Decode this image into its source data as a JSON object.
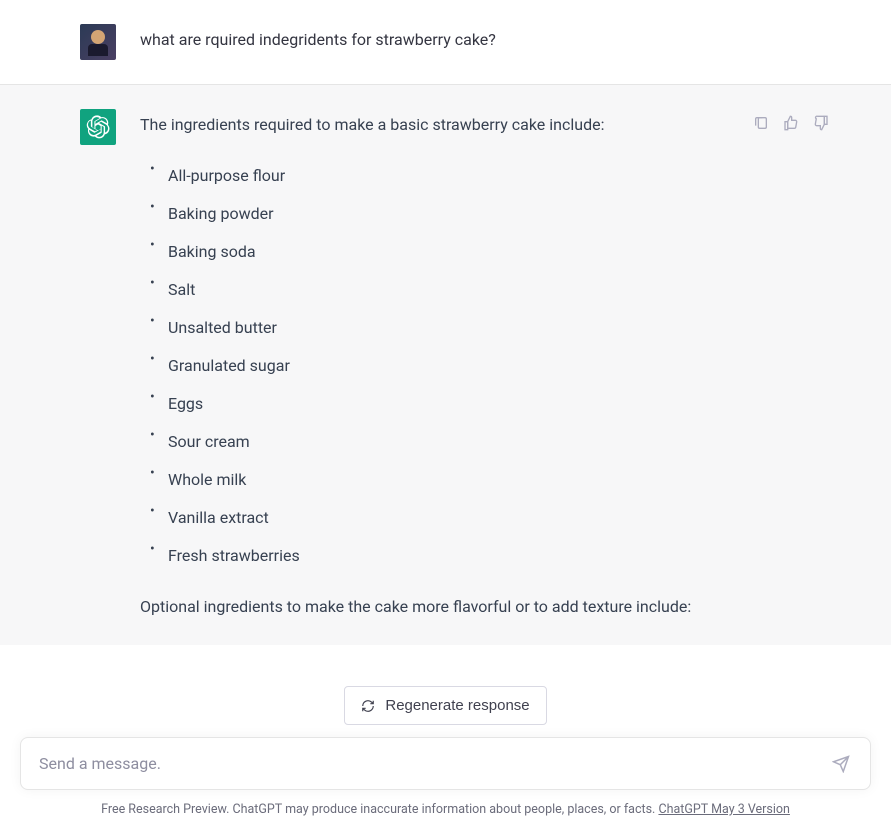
{
  "user_message": "what are rquired indegridents for strawberry cake?",
  "assistant_intro": "The ingredients required to make a basic strawberry cake include:",
  "ingredients": [
    "All-purpose flour",
    "Baking powder",
    "Baking soda",
    "Salt",
    "Unsalted butter",
    "Granulated sugar",
    "Eggs",
    "Sour cream",
    "Whole milk",
    "Vanilla extract",
    "Fresh strawberries"
  ],
  "assistant_outro": "Optional ingredients to make the cake more flavorful or to add texture include:",
  "regenerate_label": "Regenerate response",
  "input_placeholder": "Send a message.",
  "footer_text": "Free Research Preview. ChatGPT may produce inaccurate information about people, places, or facts. ",
  "footer_link": "ChatGPT May 3 Version"
}
